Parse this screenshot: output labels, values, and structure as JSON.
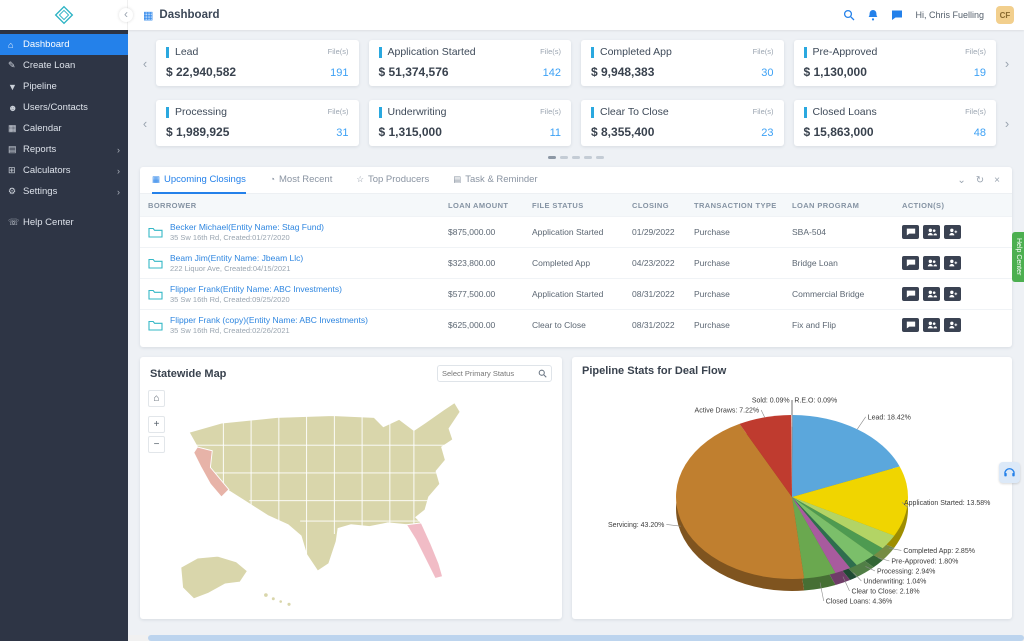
{
  "topbar": {
    "title": "Dashboard",
    "greeting": "Hi, Chris Fuelling",
    "avatar_initials": "CF"
  },
  "sidebar": {
    "items": [
      {
        "label": "Dashboard",
        "icon": "home",
        "active": true
      },
      {
        "label": "Create Loan",
        "icon": "pencil"
      },
      {
        "label": "Pipeline",
        "icon": "funnel"
      },
      {
        "label": "Users/Contacts",
        "icon": "users"
      },
      {
        "label": "Calendar",
        "icon": "calendar"
      },
      {
        "label": "Reports",
        "icon": "report",
        "expandable": true
      },
      {
        "label": "Calculators",
        "icon": "calculator",
        "expandable": true
      },
      {
        "label": "Settings",
        "icon": "gear",
        "expandable": true
      },
      {
        "label": "Help Center",
        "icon": "phone",
        "spacer": true
      }
    ]
  },
  "stat_cards": {
    "accent": "#2aa8df",
    "files_label": "File(s)",
    "rows": [
      [
        {
          "title": "Lead",
          "amount": "$ 22,940,582",
          "count": "191"
        },
        {
          "title": "Application Started",
          "amount": "$ 51,374,576",
          "count": "142"
        },
        {
          "title": "Completed App",
          "amount": "$ 9,948,383",
          "count": "30"
        },
        {
          "title": "Pre-Approved",
          "amount": "$ 1,130,000",
          "count": "19"
        }
      ],
      [
        {
          "title": "Processing",
          "amount": "$ 1,989,925",
          "count": "31"
        },
        {
          "title": "Underwriting",
          "amount": "$ 1,315,000",
          "count": "11"
        },
        {
          "title": "Clear To Close",
          "amount": "$ 8,355,400",
          "count": "23"
        },
        {
          "title": "Closed Loans",
          "amount": "$ 15,863,000",
          "count": "48"
        }
      ]
    ]
  },
  "tabs": {
    "items": [
      {
        "label": "Upcoming Closings",
        "icon": "calendar",
        "active": true
      },
      {
        "label": "Most Recent",
        "icon": "clock"
      },
      {
        "label": "Top Producers",
        "icon": "star"
      },
      {
        "label": "Task & Reminder",
        "icon": "task"
      }
    ]
  },
  "table": {
    "columns": [
      "BORROWER",
      "LOAN AMOUNT",
      "FILE STATUS",
      "CLOSING",
      "TRANSACTION TYPE",
      "LOAN PROGRAM",
      "ACTION(S)"
    ],
    "rows": [
      {
        "borrower": "Becker Michael(Entity Name: Stag Fund)",
        "details": "35 Sw 16th Rd, Created:01/27/2020",
        "amount": "$875,000.00",
        "status": "Application Started",
        "closing": "01/29/2022",
        "transaction_type": "Purchase",
        "program": "SBA-504"
      },
      {
        "borrower": "Beam Jim(Entity Name: Jbeam Llc)",
        "details": "222 Liquor Ave, Created:04/15/2021",
        "amount": "$323,800.00",
        "status": "Completed App",
        "closing": "04/23/2022",
        "transaction_type": "Purchase",
        "program": "Bridge Loan"
      },
      {
        "borrower": "Flipper Frank(Entity Name: ABC Investments)",
        "details": "35 Sw 16th Rd, Created:09/25/2020",
        "amount": "$577,500.00",
        "status": "Application Started",
        "closing": "08/31/2022",
        "transaction_type": "Purchase",
        "program": "Commercial Bridge"
      },
      {
        "borrower": "Flipper Frank (copy)(Entity Name: ABC Investments)",
        "details": "35 Sw 16th Rd, Created:02/26/2021",
        "amount": "$625,000.00",
        "status": "Clear to Close",
        "closing": "08/31/2022",
        "transaction_type": "Purchase",
        "program": "Fix and Flip"
      }
    ]
  },
  "map": {
    "title": "Statewide Map",
    "search_placeholder": "Select Primary Status",
    "colors": {
      "base": "#d9d6ab",
      "california": "#e7b3a8",
      "florida": "#f1bcc6"
    }
  },
  "chart_data": {
    "type": "pie",
    "title": "Pipeline Stats for Deal Flow",
    "legend_position": "labels-around",
    "labels": [
      "R.E.O",
      "Lead",
      "Application Started",
      "Completed App",
      "Pre-Approved",
      "Processing",
      "Underwriting",
      "Clear to Close",
      "Closed Loans",
      "Servicing",
      "Active Draws",
      "Sold"
    ],
    "values": [
      0.09,
      18.42,
      13.58,
      2.85,
      1.8,
      2.94,
      1.04,
      2.18,
      4.36,
      43.2,
      7.22,
      0.09
    ],
    "colors": [
      "#8a8a8a",
      "#5ba7dc",
      "#f0d500",
      "#b3d465",
      "#4e9a51",
      "#7bbf6a",
      "#2e6e4e",
      "#a85b9e",
      "#6aa84f",
      "#c07f2f",
      "#bf3b2f",
      "#d8d8d8"
    ]
  },
  "help_tab_label": "Help Center",
  "carousel": {
    "prev": "‹",
    "next": "›"
  }
}
